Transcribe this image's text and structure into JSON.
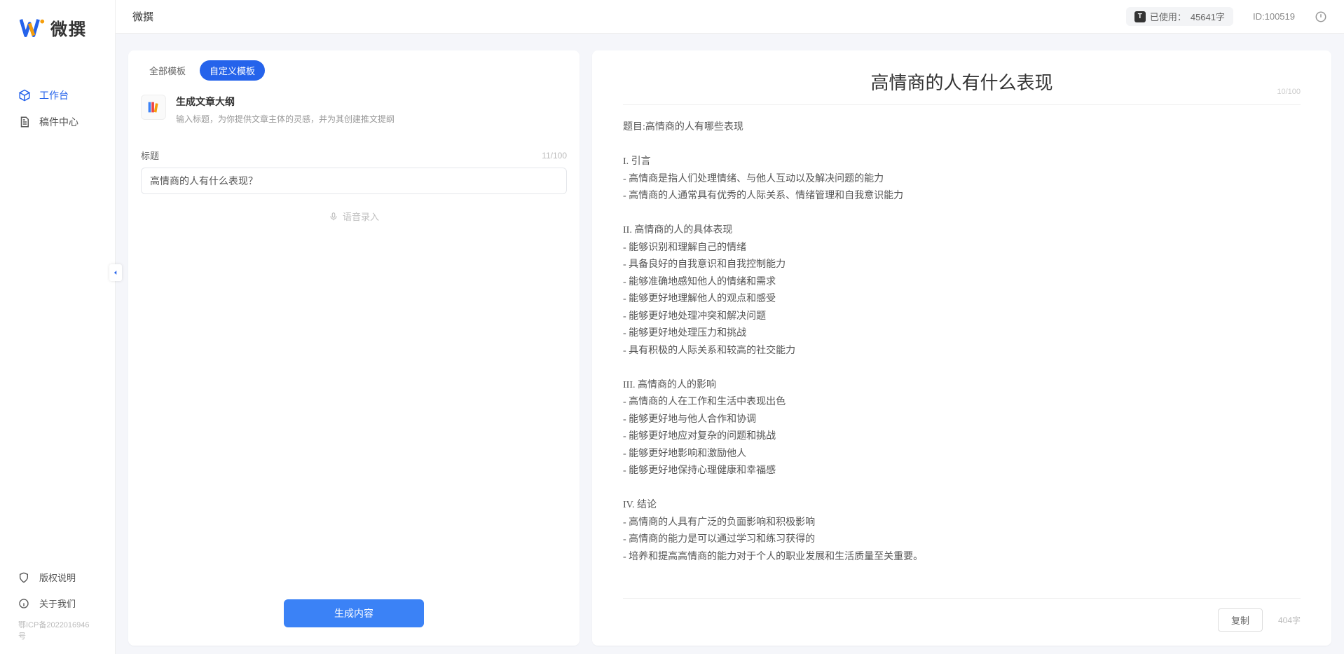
{
  "brand": {
    "name": "微撰"
  },
  "sidebar": {
    "items": [
      {
        "label": "工作台",
        "active": true
      },
      {
        "label": "稿件中心",
        "active": false
      }
    ],
    "bottom": [
      {
        "label": "版权说明"
      },
      {
        "label": "关于我们"
      }
    ],
    "icp": "鄂ICP备2022016946号"
  },
  "topbar": {
    "title": "微撰",
    "usage_prefix": "已使用：",
    "usage_value": "45641字",
    "id_label": "ID:100519"
  },
  "left": {
    "tabs": [
      {
        "label": "全部模板",
        "active": false
      },
      {
        "label": "自定义模板",
        "active": true
      }
    ],
    "template": {
      "title": "生成文章大纲",
      "desc": "输入标题，为你提供文章主体的灵感，并为其创建推文提纲"
    },
    "form": {
      "title_label": "标题",
      "title_count": "11/100",
      "title_value": "高情商的人有什么表现？",
      "voice_label": "语音录入"
    },
    "generate_label": "生成内容"
  },
  "right": {
    "title": "高情商的人有什么表现",
    "top_count": "10/100",
    "body": "题目:高情商的人有哪些表现\n\nI. 引言\n- 高情商是指人们处理情绪、与他人互动以及解决问题的能力\n- 高情商的人通常具有优秀的人际关系、情绪管理和自我意识能力\n\nII. 高情商的人的具体表现\n- 能够识别和理解自己的情绪\n- 具备良好的自我意识和自我控制能力\n- 能够准确地感知他人的情绪和需求\n- 能够更好地理解他人的观点和感受\n- 能够更好地处理冲突和解决问题\n- 能够更好地处理压力和挑战\n- 具有积极的人际关系和较高的社交能力\n\nIII. 高情商的人的影响\n- 高情商的人在工作和生活中表现出色\n- 能够更好地与他人合作和协调\n- 能够更好地应对复杂的问题和挑战\n- 能够更好地影响和激励他人\n- 能够更好地保持心理健康和幸福感\n\nIV. 结论\n- 高情商的人具有广泛的负面影响和积极影响\n- 高情商的能力是可以通过学习和练习获得的\n- 培养和提高高情商的能力对于个人的职业发展和生活质量至关重要。",
    "copy_label": "复制",
    "word_count": "404字"
  }
}
